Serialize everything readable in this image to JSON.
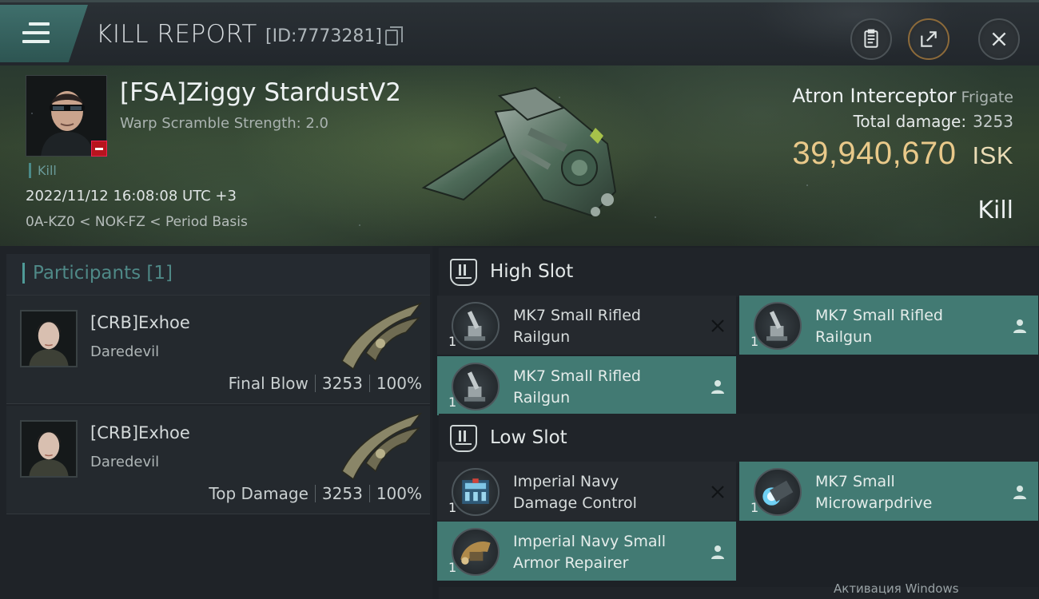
{
  "header": {
    "title": "KILL REPORT",
    "report_id": "[ID:7773281]"
  },
  "victim": {
    "name": "[FSA]Ziggy StardustV2",
    "warp_scramble": "Warp Scramble Strength: 2.0",
    "kill_tag": "Kill",
    "timestamp": "2022/11/12 16:08:08 UTC +3",
    "location": "0A-KZ0 < NOK-FZ < Period Basis",
    "ship": "Atron Interceptor",
    "ship_class": "Frigate",
    "total_damage_label": "Total damage:",
    "total_damage": "3253",
    "isk_value": "39,940,670",
    "isk_unit": "ISK",
    "result": "Kill"
  },
  "participants": {
    "header": "Participants [1]",
    "items": [
      {
        "name": "[CRB]Exhoe",
        "ship": "Daredevil",
        "role": "Final Blow",
        "damage": "3253",
        "percent": "100%"
      },
      {
        "name": "[CRB]Exhoe",
        "ship": "Daredevil",
        "role": "Top Damage",
        "damage": "3253",
        "percent": "100%"
      }
    ]
  },
  "fitting": {
    "high_slot": {
      "label": "High Slot",
      "modules": [
        {
          "line1": "MK7 Small Rifled",
          "line2": "Railgun",
          "qty": "1",
          "state": "destroyed"
        },
        {
          "line1": "MK7 Small Rifled",
          "line2": "Railgun",
          "qty": "1",
          "state": "dropped"
        },
        {
          "line1": "MK7 Small Rifled",
          "line2": "Railgun",
          "qty": "1",
          "state": "dropped"
        }
      ]
    },
    "low_slot": {
      "label": "Low Slot",
      "modules": [
        {
          "line1": "Imperial Navy",
          "line2": "Damage Control",
          "qty": "1",
          "state": "destroyed"
        },
        {
          "line1": "MK7 Small",
          "line2": "Microwarpdrive",
          "qty": "1",
          "state": "dropped"
        },
        {
          "line1": "Imperial Navy Small",
          "line2": "Armor Repairer",
          "qty": "1",
          "state": "dropped"
        }
      ]
    }
  },
  "watermark": "Активация Windows",
  "colors": {
    "accent_teal": "#427a73",
    "isk_gold": "#e9c98a",
    "destroyed_red": "#b8141e"
  },
  "icons": [
    "menu-icon",
    "copy-icon",
    "clipboard-icon",
    "share-icon",
    "close-icon",
    "slot-icon",
    "pilot-icon",
    "x-icon"
  ]
}
